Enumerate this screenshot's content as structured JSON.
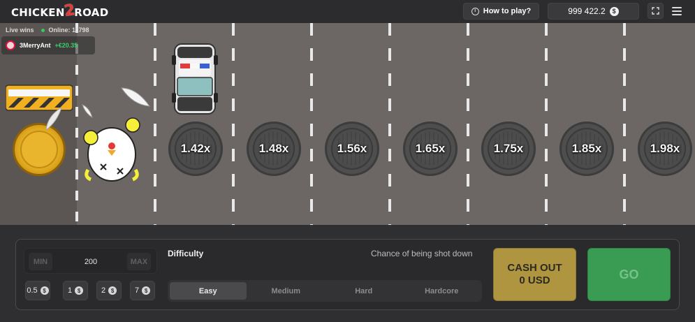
{
  "header": {
    "logo_prefix": "CHICKEN",
    "logo_number": "2",
    "logo_suffix": "ROAD",
    "how_to_play": "How to play?",
    "balance": "999 422.2",
    "currency_symbol": "$"
  },
  "live": {
    "label": "Live wins",
    "online": "Online: 11798",
    "winner_name": "3MerryAnt",
    "winner_amount": "+€20.35"
  },
  "lanes": {
    "multipliers": [
      "1.42x",
      "1.48x",
      "1.56x",
      "1.65x",
      "1.75x",
      "1.85x",
      "1.98x"
    ]
  },
  "controls": {
    "min_label": "MIN",
    "max_label": "MAX",
    "bet_value": "200",
    "chips": [
      "0.5",
      "1",
      "2",
      "7"
    ],
    "chip_symbol": "$",
    "difficulty_label": "Difficulty",
    "chance_label": "Chance of being shot down",
    "difficulty_tabs": [
      "Easy",
      "Medium",
      "Hard",
      "Hardcore"
    ],
    "selected_difficulty": "Easy",
    "cashout_line1": "CASH OUT",
    "cashout_line2": "0 USD",
    "go_label": "GO"
  },
  "colors": {
    "road": "#6c6764",
    "go": "#3a9c52",
    "cashout": "#b09540",
    "win_green": "#3ad06b"
  }
}
